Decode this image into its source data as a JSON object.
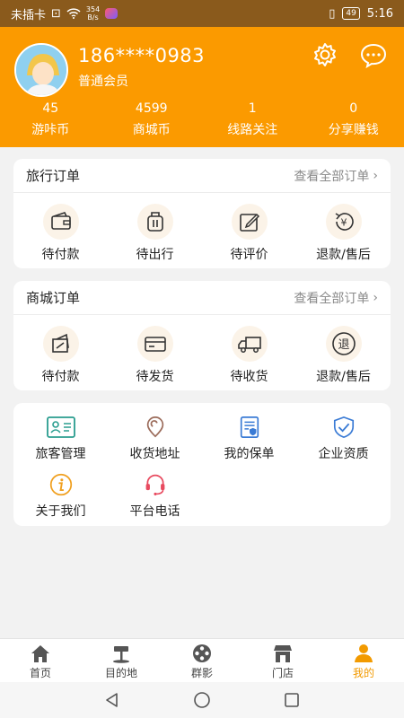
{
  "status_bar": {
    "carrier": "未插卡",
    "net_speed_value": "354",
    "net_speed_unit": "B/s",
    "battery": "49",
    "time": "5:16"
  },
  "profile": {
    "phone": "186****0983",
    "level": "普通会员"
  },
  "stats": [
    {
      "value": "45",
      "label": "游咔币"
    },
    {
      "value": "4599",
      "label": "商城币"
    },
    {
      "value": "1",
      "label": "线路关注"
    },
    {
      "value": "0",
      "label": "分享赚钱"
    }
  ],
  "travel_orders": {
    "title": "旅行订单",
    "view_all": "查看全部订单",
    "items": [
      {
        "label": "待付款",
        "icon": "wallet-icon"
      },
      {
        "label": "待出行",
        "icon": "luggage-icon"
      },
      {
        "label": "待评价",
        "icon": "edit-icon"
      },
      {
        "label": "退款/售后",
        "icon": "refund-icon"
      }
    ]
  },
  "mall_orders": {
    "title": "商城订单",
    "view_all": "查看全部订单",
    "items": [
      {
        "label": "待付款",
        "icon": "payment-icon"
      },
      {
        "label": "待发货",
        "icon": "card-icon"
      },
      {
        "label": "待收货",
        "icon": "truck-icon"
      },
      {
        "label": "退款/售后",
        "icon": "return-icon"
      }
    ]
  },
  "services": [
    {
      "label": "旅客管理",
      "icon": "id-card-icon",
      "color": "#2a9d8f"
    },
    {
      "label": "收货地址",
      "icon": "location-icon",
      "color": "#9b6b5a"
    },
    {
      "label": "我的保单",
      "icon": "policy-icon",
      "color": "#3a7bd5"
    },
    {
      "label": "企业资质",
      "icon": "shield-check-icon",
      "color": "#3a7bd5"
    },
    {
      "label": "关于我们",
      "icon": "info-icon",
      "color": "#f0a020"
    },
    {
      "label": "平台电话",
      "icon": "headset-icon",
      "color": "#e84a5f"
    }
  ],
  "tabs": [
    {
      "label": "首页",
      "icon": "home-icon"
    },
    {
      "label": "目的地",
      "icon": "signpost-icon"
    },
    {
      "label": "群影",
      "icon": "film-reel-icon"
    },
    {
      "label": "门店",
      "icon": "store-icon"
    },
    {
      "label": "我的",
      "icon": "person-icon"
    }
  ],
  "colors": {
    "accent": "#fb9a00",
    "status_bar": "#8a5a1c",
    "active_tab": "#f29a00",
    "page_bg": "#f2f2f2"
  }
}
